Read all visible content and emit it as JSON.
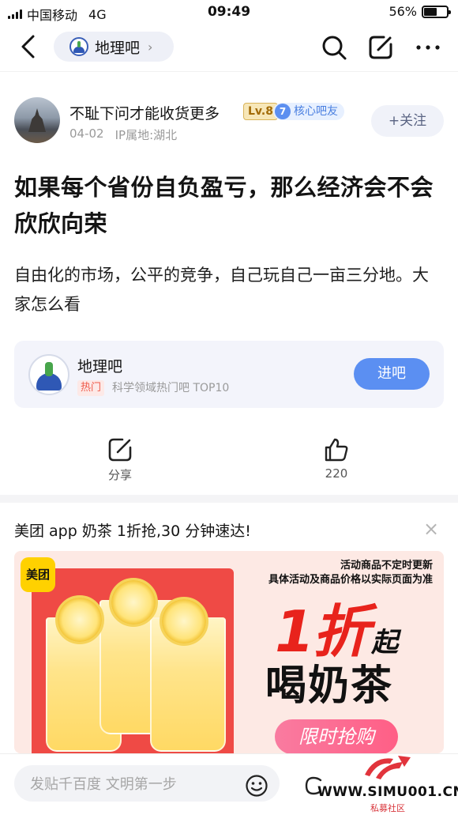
{
  "status_bar": {
    "carrier": "中国移动",
    "network": "4G",
    "time": "09:49",
    "battery": "56%",
    "battery_level": 0.56
  },
  "nav": {
    "forum_name": "地理吧",
    "chevron": "›",
    "icons": [
      "back-icon",
      "search-icon",
      "edit-icon",
      "more-icon"
    ]
  },
  "author": {
    "name": "不耻下问才能收货更多",
    "level": "Lv.8",
    "core_number": "7",
    "core_label": "核心吧友",
    "date": "04-02",
    "ip": "IP属地:湖北",
    "follow_label": "+关注"
  },
  "post": {
    "title": "如果每个省份自负盈亏，那么经济会不会欣欣向荣",
    "body": "自由化的市场，公平的竞争，自己玩自己一亩三分地。大家怎么看"
  },
  "forum_card": {
    "name": "地理吧",
    "tag": "热门",
    "description": "科学领域热门吧 TOP10",
    "enter_label": "进吧"
  },
  "actions": {
    "share_label": "分享",
    "like_count": "220"
  },
  "ad": {
    "title": "美团 app 奶茶 1折抢,30 分钟速达!",
    "close": "×",
    "brand": "美团",
    "notice_line1": "活动商品不定时更新",
    "notice_line2": "具体活动及商品价格以实际页面为准",
    "discount": "1折",
    "discount_suffix": "起",
    "headline": "喝奶茶",
    "cta": "限时抢购"
  },
  "bottom_bar": {
    "input_placeholder": "发贴千百度 文明第一步"
  },
  "watermark": {
    "url": "WWW.SIMU001.CN",
    "sub": "私募社区"
  },
  "colors": {
    "accent_blue": "#5b8ff2",
    "level_gold": "#d9b459",
    "hot_red": "#ef5a4a",
    "ad_red": "#e8231c"
  }
}
